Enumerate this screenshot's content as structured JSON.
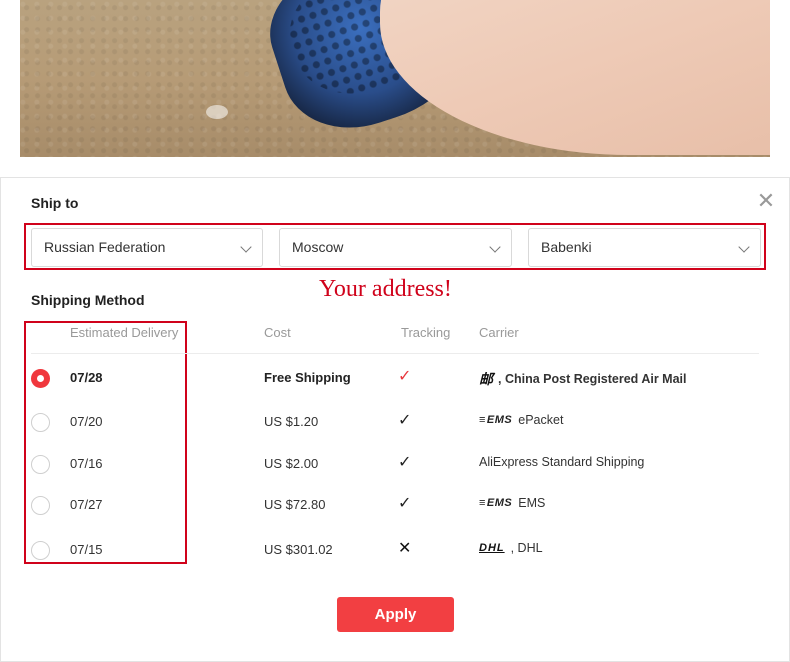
{
  "ship_to": {
    "title": "Ship to",
    "country": "Russian Federation",
    "city": "Moscow",
    "district": "Babenki",
    "annotation": "Your address!"
  },
  "shipping_method": {
    "title": "Shipping Method",
    "columns": [
      "Estimated Delivery",
      "Cost",
      "Tracking",
      "Carrier"
    ],
    "rows": [
      {
        "date": "07/28",
        "cost": "Free Shipping",
        "tracking": "✓",
        "carrier_logo": "china-post-logo",
        "carrier": ", China Post Registered Air Mail",
        "selected": true
      },
      {
        "date": "07/20",
        "cost": "US $1.20",
        "tracking": "✓",
        "carrier_logo": "ems-logo",
        "carrier": "ePacket",
        "selected": false
      },
      {
        "date": "07/16",
        "cost": "US $2.00",
        "tracking": "✓",
        "carrier_logo": "",
        "carrier": "AliExpress Standard Shipping",
        "selected": false
      },
      {
        "date": "07/27",
        "cost": "US $72.80",
        "tracking": "✓",
        "carrier_logo": "ems-logo",
        "carrier": "EMS",
        "selected": false
      },
      {
        "date": "07/15",
        "cost": "US $301.02",
        "tracking": "✕",
        "carrier_logo": "dhl-logo",
        "carrier": ", DHL",
        "selected": false
      }
    ]
  },
  "logos": {
    "china_post": "邮",
    "ems": "EMS",
    "dhl": "DHL"
  },
  "apply_label": "Apply",
  "colors": {
    "accent": "#f23f42",
    "annotation_red": "#d0021b",
    "tick_red": "#e8373d"
  }
}
